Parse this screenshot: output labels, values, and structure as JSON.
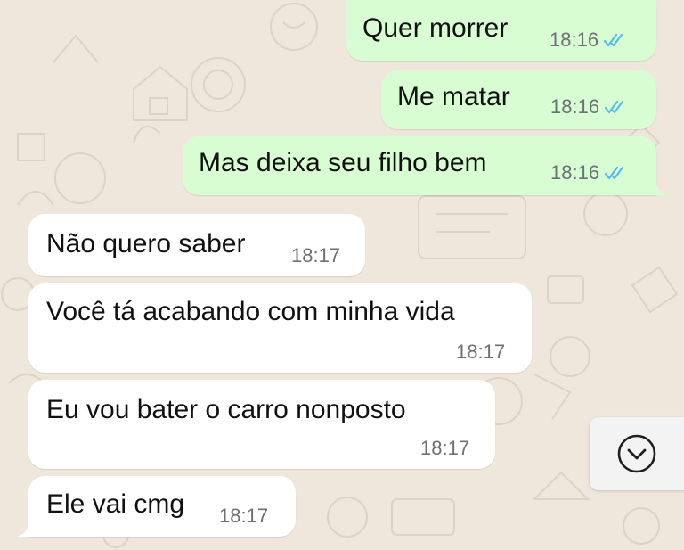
{
  "chat": {
    "messages": [
      {
        "direction": "out",
        "text": "Quer morrer",
        "time": "18:16",
        "status": "read"
      },
      {
        "direction": "out",
        "text": "Me matar",
        "time": "18:16",
        "status": "read"
      },
      {
        "direction": "out",
        "text": "Mas deixa seu filho bem",
        "time": "18:16",
        "status": "read"
      },
      {
        "direction": "in",
        "text": "Não quero saber",
        "time": "18:17"
      },
      {
        "direction": "in",
        "text": "Você tá acabando com minha vida",
        "time": "18:17"
      },
      {
        "direction": "in",
        "text": "Eu vou bater o carro nonposto",
        "time": "18:17"
      },
      {
        "direction": "in",
        "text": "Ele vai cmg",
        "time": "18:17"
      }
    ]
  },
  "icons": {
    "read_receipt": "double-check-icon",
    "scroll_down": "chevron-down-circle-icon"
  },
  "colors": {
    "outgoing_bubble": "#d9fdd3",
    "incoming_bubble": "#ffffff",
    "background": "#efe7dc",
    "read_ticks": "#53bdeb"
  }
}
